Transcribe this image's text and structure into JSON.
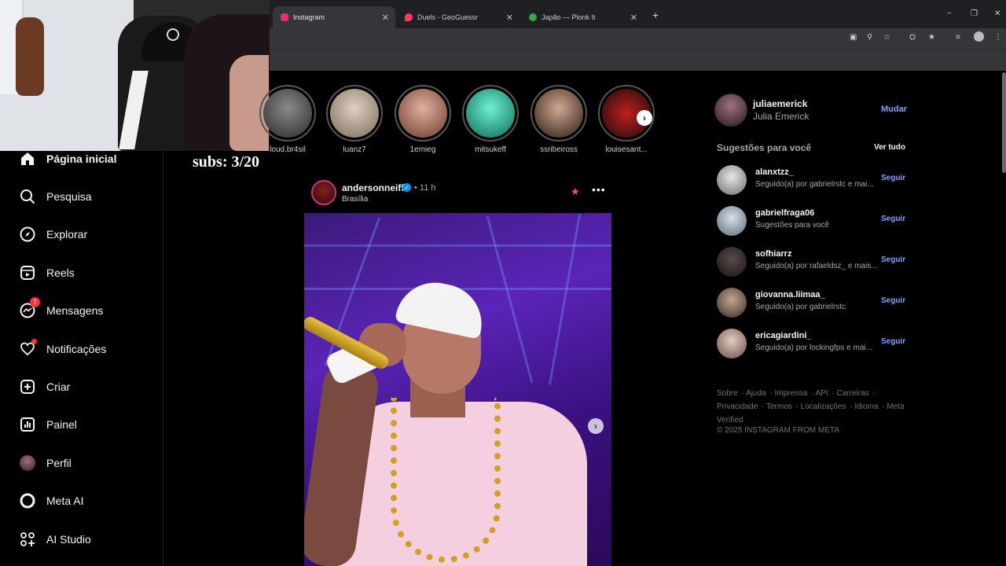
{
  "browser": {
    "tabs": [
      {
        "label": "Instagram",
        "icon": "instagram-icon",
        "color": "#e1306c"
      },
      {
        "label": "Duels - GeoGuessr",
        "icon": "map-pin-icon",
        "color": "#ff3b5c"
      },
      {
        "label": "Japão — Plonk It",
        "icon": "globe-icon",
        "color": "#34a853"
      }
    ],
    "new_tab": "+",
    "window_controls": [
      "−",
      "❐",
      "✕"
    ]
  },
  "overlay": {
    "subs": "subs: 3/20"
  },
  "nav": {
    "items": [
      {
        "label": "Página inicial",
        "icon": "home-icon"
      },
      {
        "label": "Pesquisa",
        "icon": "search-icon"
      },
      {
        "label": "Explorar",
        "icon": "compass-icon"
      },
      {
        "label": "Reels",
        "icon": "reels-icon"
      },
      {
        "label": "Mensagens",
        "icon": "messenger-icon",
        "badge": "7"
      },
      {
        "label": "Notificações",
        "icon": "heart-icon"
      },
      {
        "label": "Criar",
        "icon": "plus-square-icon"
      },
      {
        "label": "Painel",
        "icon": "dashboard-icon"
      },
      {
        "label": "Perfil",
        "icon": "profile-avatar"
      },
      {
        "label": "Meta AI",
        "icon": "meta-ai-icon"
      },
      {
        "label": "AI Studio",
        "icon": "ai-studio-icon"
      }
    ]
  },
  "stories": [
    {
      "name": "loud.br4sil",
      "color": "#6a6a6a"
    },
    {
      "name": "luanz7",
      "color": "#c9b8a8"
    },
    {
      "name": "1emieg",
      "color": "#b07a6a"
    },
    {
      "name": "mitsukeff",
      "color": "#2fb8a0"
    },
    {
      "name": "ssribeiross",
      "color": "#8a6a5a"
    },
    {
      "name": "louisesant...",
      "color": "#7a1a1a"
    }
  ],
  "post": {
    "username": "andersonneiff",
    "time": "• 11 h",
    "location": "Brasília",
    "more": "•••",
    "verified": "✓"
  },
  "sidebar": {
    "me": {
      "username": "juliaemerick",
      "name": "Julia Emerick",
      "switch": "Mudar"
    },
    "suggestions_title": "Sugestões para você",
    "see_all": "Ver tudo",
    "follow_label": "Seguir",
    "suggestions": [
      {
        "username": "alanxtzz_",
        "sub": "Seguido(a) por gabrielrstc e mai...",
        "color": "#d8d8d8"
      },
      {
        "username": "gabrielfraga06",
        "sub": "Sugestões para você",
        "color": "#c8d0d8"
      },
      {
        "username": "sofhiarrz",
        "sub": "Seguido(a) por rafaeldsz_ e mais...",
        "color": "#3a3030"
      },
      {
        "username": "giovanna.liimaa_",
        "sub": "Seguido(a) por gabrielrstc",
        "color": "#9a8070"
      },
      {
        "username": "ericagiardini_",
        "sub": "Seguido(a) por lockingfps e mai...",
        "color": "#c8b0a0"
      }
    ],
    "footer_links": [
      "Sobre",
      "Ajuda",
      "Imprensa",
      "API",
      "Carreiras",
      "Privacidade",
      "Termos",
      "Localizações",
      "Idioma",
      "Meta Verified"
    ],
    "copyright": "© 2025 INSTAGRAM FROM META"
  }
}
